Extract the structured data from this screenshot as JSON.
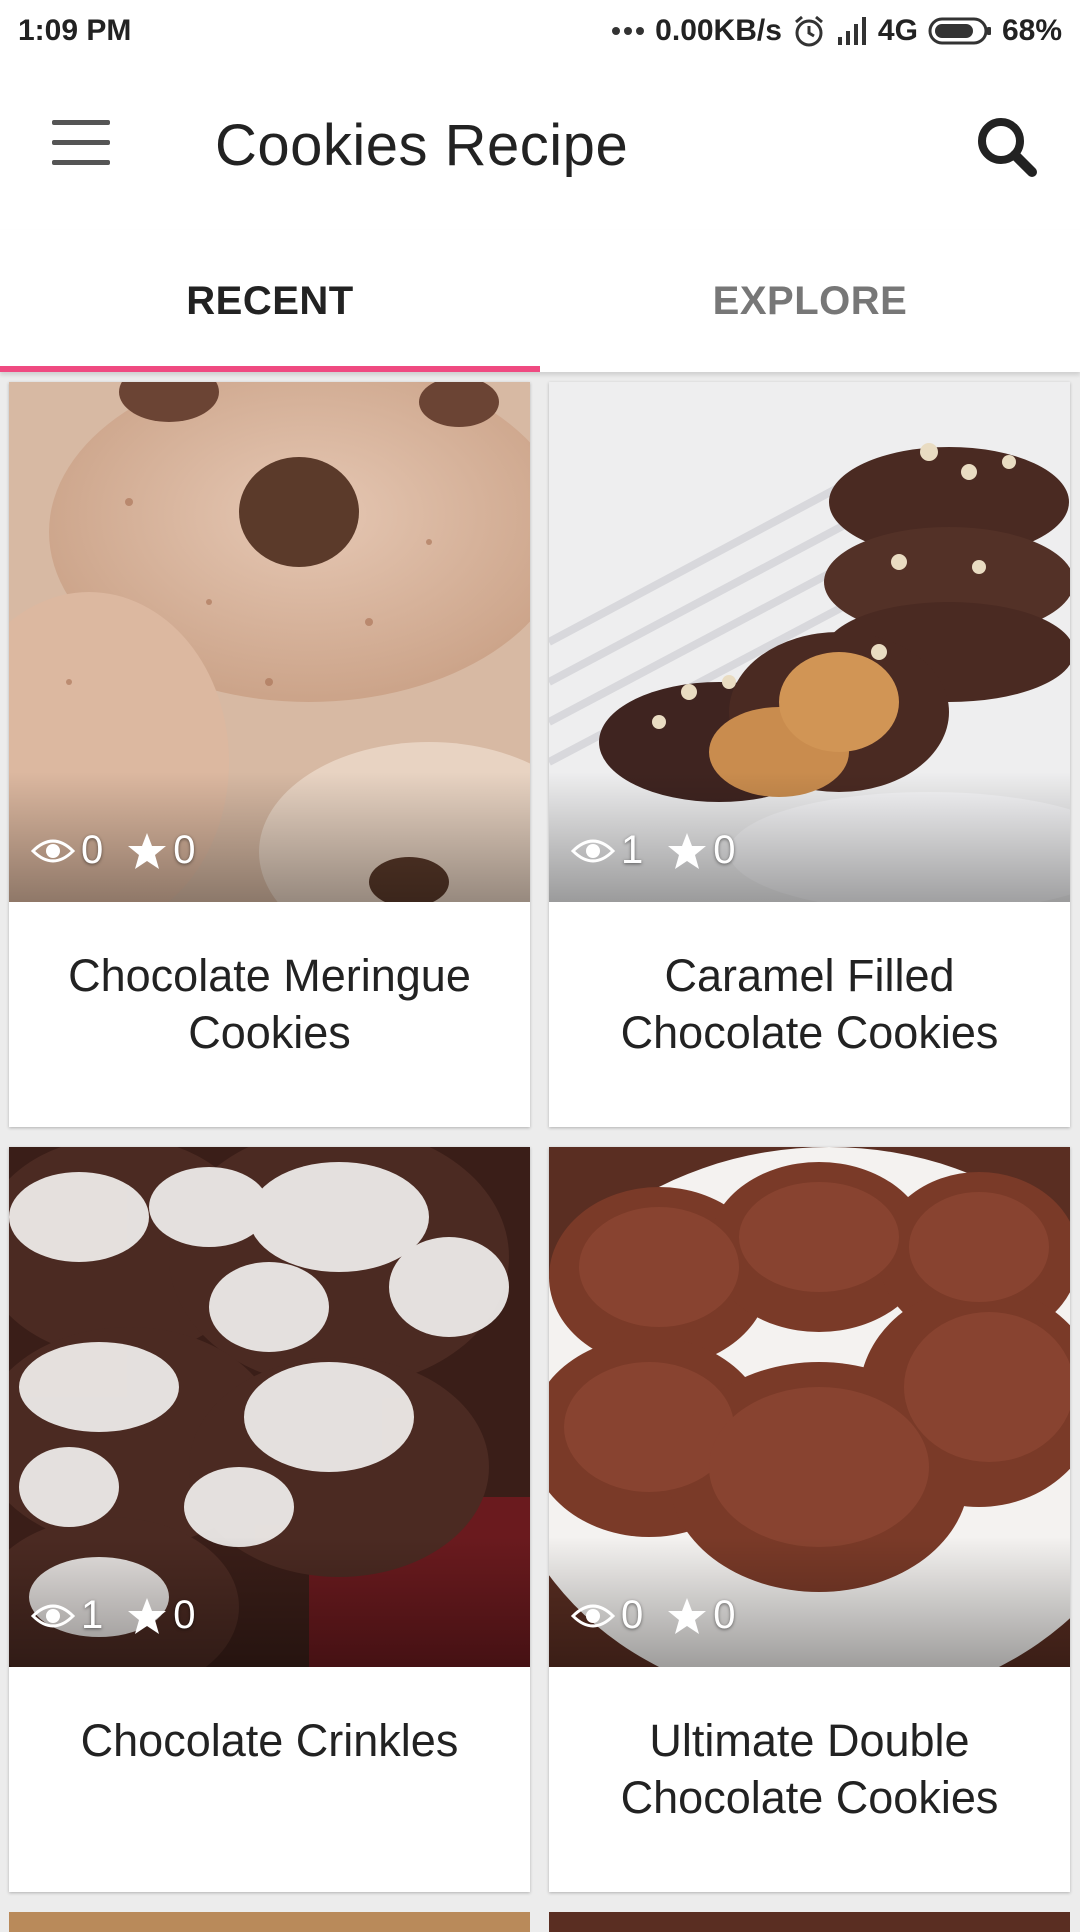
{
  "status_bar": {
    "time": "1:09 PM",
    "net_speed": "0.00KB/s",
    "network": "4G",
    "battery": "68%"
  },
  "app_bar": {
    "title": "Cookies Recipe",
    "menu_icon": "hamburger-menu-icon",
    "search_icon": "search-icon"
  },
  "tabs": [
    {
      "label": "RECENT",
      "active": true
    },
    {
      "label": "EXPLORE",
      "active": false
    }
  ],
  "accent_color": "#ef4a81",
  "recipes": [
    {
      "title_line1": "Chocolate Meringue",
      "title_line2": "Cookies",
      "views": "0",
      "stars": "0"
    },
    {
      "title_line1": "Caramel Filled",
      "title_line2": "Chocolate Cookies",
      "views": "1",
      "stars": "0"
    },
    {
      "title_line1": "Chocolate Crinkles",
      "title_line2": "",
      "views": "1",
      "stars": "0"
    },
    {
      "title_line1": "Ultimate Double",
      "title_line2": "Chocolate Cookies",
      "views": "0",
      "stars": "0"
    }
  ]
}
